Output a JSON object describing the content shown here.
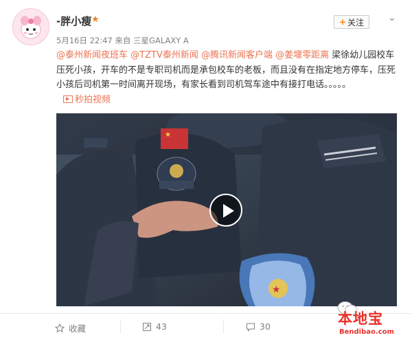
{
  "post": {
    "username": "-胖小瘦",
    "follow_label": "关注",
    "date": "5月16日 22:47",
    "source_prefix": "来自",
    "device": "三星GALAXY A",
    "mentions": [
      "@泰州新闻夜班车",
      "@TZTV泰州新闻",
      "@腾讯新闻客户端",
      "@姜堰零距离"
    ],
    "body": " 梁徐幼儿园校车压死小孩，开车的不是专职司机而是承包校车的老板，而且没有在指定地方停车，压死小孩后司机第一时间离开现场，有家长看到司机驾车途中有接打电话。。。。。",
    "video_label": "秒拍视频"
  },
  "actions": {
    "favorite": "收藏",
    "repost_count": "43",
    "comment_count": "30"
  },
  "watermark": {
    "name": "本地宝",
    "url": "Bendibao.com"
  },
  "icons": {
    "vip": "star-badge-icon",
    "chevron": "chevron-down-icon",
    "play": "play-icon"
  },
  "colors": {
    "mention": "#eb7350",
    "follow_plus": "#ff8200",
    "watermark": "#e8312a"
  }
}
